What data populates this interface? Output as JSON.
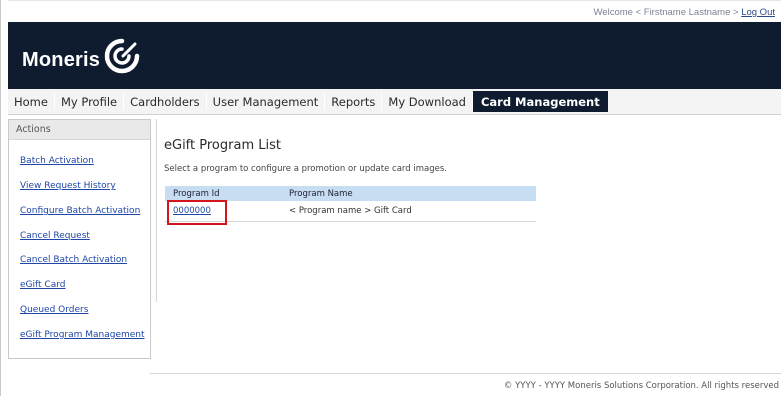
{
  "header": {
    "welcome_text": "Welcome < Firstname Lastname >",
    "logout_label": "Log Out",
    "logo_text": "Moneris",
    "logo_icon": "moneris-swirl-icon"
  },
  "nav": {
    "items": [
      {
        "label": "Home"
      },
      {
        "label": "My Profile"
      },
      {
        "label": "Cardholders"
      },
      {
        "label": "User Management"
      },
      {
        "label": "Reports"
      },
      {
        "label": "My Download"
      },
      {
        "label": "Card Management",
        "active": true
      }
    ]
  },
  "sidebar": {
    "title": "Actions",
    "items": [
      {
        "label": "Batch Activation"
      },
      {
        "label": "View Request History"
      },
      {
        "label": "Configure Batch Activation"
      },
      {
        "label": "Cancel Request"
      },
      {
        "label": "Cancel Batch Activation"
      },
      {
        "label": "eGift Card"
      },
      {
        "label": "Queued Orders"
      },
      {
        "label": "eGift Program Management"
      }
    ]
  },
  "main": {
    "title": "eGift Program List",
    "description": "Select a program to configure a promotion or update card images.",
    "table": {
      "headers": [
        "Program Id",
        "Program Name"
      ],
      "rows": [
        {
          "program_id": "0000000",
          "program_name": "< Program name > Gift Card"
        }
      ]
    }
  },
  "footer": {
    "copyright": "© YYYY - YYYY  Moneris Solutions Corporation. All rights reserved"
  },
  "colors": {
    "banner": "#0f1c30",
    "link": "#2047a8",
    "table_header": "#c7ddf2",
    "highlight": "#d2161b"
  }
}
